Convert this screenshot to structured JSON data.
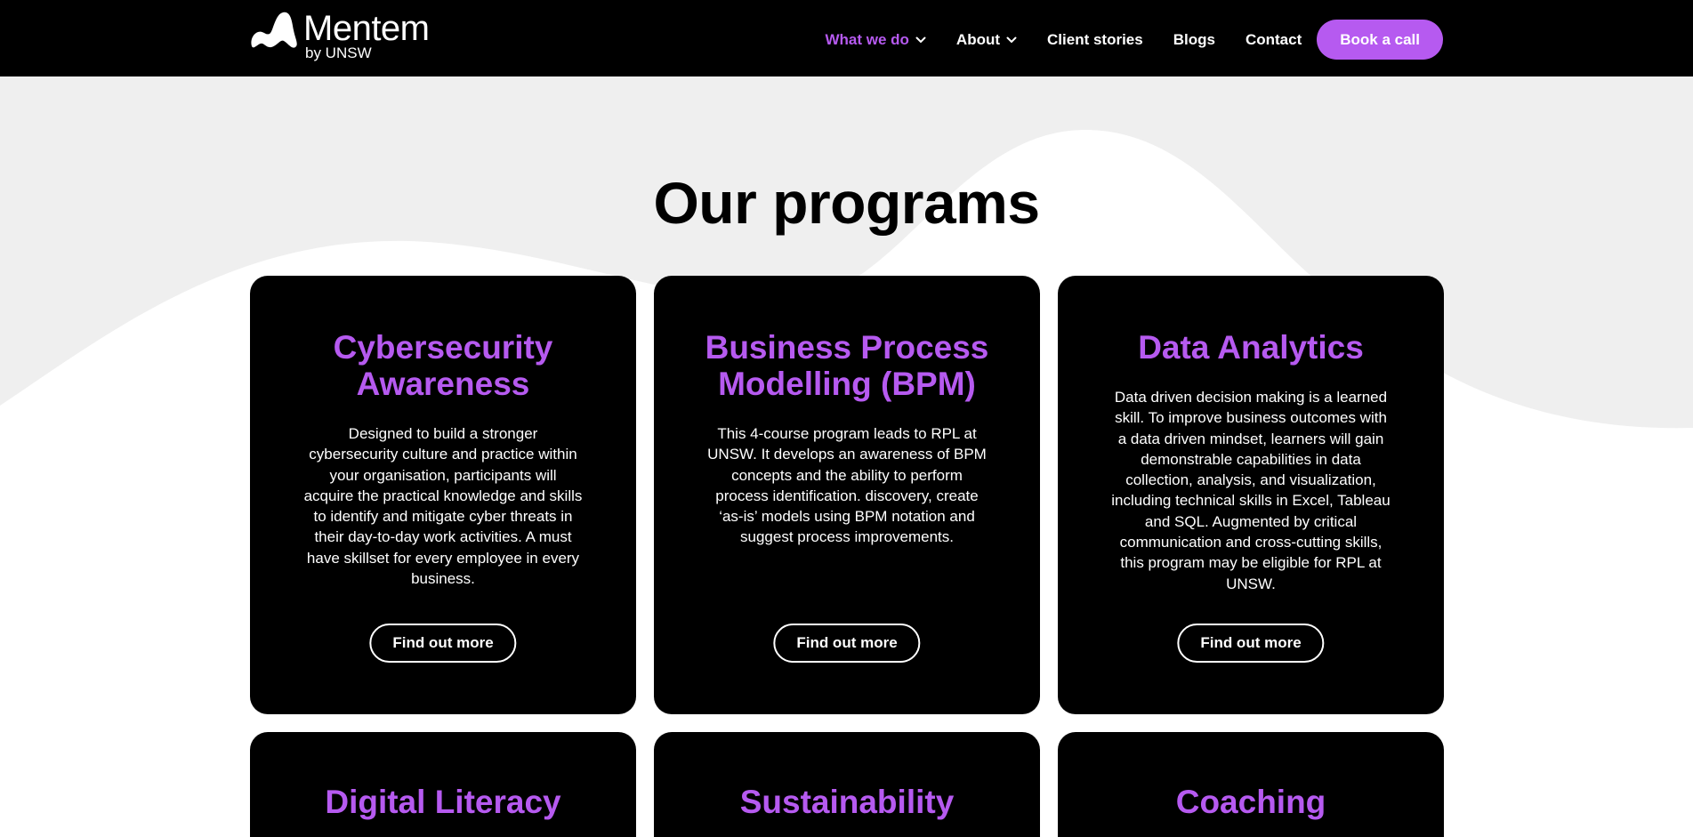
{
  "brand": {
    "name": "Mentem",
    "sub": "by UNSW",
    "logo_icon": "mountain-wave-logo",
    "accent_color": "#b65af0"
  },
  "nav": {
    "items": [
      {
        "label": "What we do",
        "dropdown": true,
        "active": true
      },
      {
        "label": "About",
        "dropdown": true,
        "active": false
      },
      {
        "label": "Client stories",
        "dropdown": false,
        "active": false
      },
      {
        "label": "Blogs",
        "dropdown": false,
        "active": false
      },
      {
        "label": "Contact",
        "dropdown": false,
        "active": false
      }
    ],
    "cta_label": "Book a call"
  },
  "programs": {
    "title": "Our programs",
    "cards": [
      {
        "title": "Cybersecurity Awareness",
        "title_lines": [
          "Cybersecurity",
          "Awareness"
        ],
        "description": "Designed to build a stronger cybersecurity culture and practice within your organisation, participants will acquire the practical knowledge and skills to identify and mitigate cyber threats in their day-to-day work activities. A must have skillset for every employee in every business.",
        "button_label": "Find out more"
      },
      {
        "title": "Business Process Modelling (BPM)",
        "title_lines": [
          "Business Process",
          "Modelling (BPM)"
        ],
        "description": "This 4-course program leads to RPL at UNSW. It develops an awareness of BPM concepts and the ability to perform process identification. discovery, create ‘as-is’ models using BPM notation and suggest process improvements.",
        "button_label": "Find out more"
      },
      {
        "title": "Data Analytics",
        "title_lines": [
          "Data Analytics"
        ],
        "description": "Data driven decision making is a learned skill. To improve business outcomes with a data driven mindset, learners will gain demonstrable capabilities in data collection, analysis, and visualization, including technical skills in Excel, Tableau and SQL. Augmented by critical communication and cross-cutting skills, this program may be eligible for RPL at UNSW.",
        "button_label": "Find out more"
      },
      {
        "title": "Digital Literacy",
        "title_lines": [
          "Digital Literacy"
        ]
      },
      {
        "title": "Sustainability",
        "title_lines": [
          "Sustainability"
        ]
      },
      {
        "title": "Coaching",
        "title_lines": [
          "Coaching"
        ]
      }
    ]
  }
}
